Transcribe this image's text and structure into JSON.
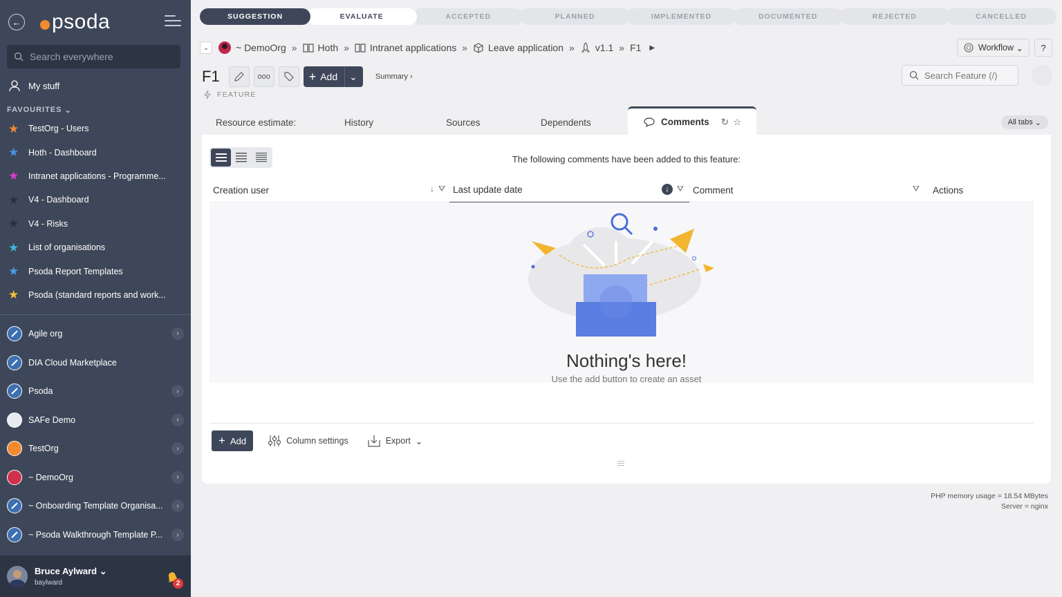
{
  "sidebar": {
    "logo_text": "psoda",
    "search_placeholder": "Search everywhere",
    "my_stuff": "My stuff",
    "favourites_heading": "FAVOURITES",
    "favourites": [
      {
        "label": "TestOrg - Users",
        "color": "#f28a30"
      },
      {
        "label": "Hoth - Dashboard",
        "color": "#4a90e2"
      },
      {
        "label": "Intranet applications - Programme...",
        "color": "#d63fcf"
      },
      {
        "label": "V4 - Dashboard",
        "color": "#2a2f38"
      },
      {
        "label": "V4 - Risks",
        "color": "#2a2f38"
      },
      {
        "label": "List of organisations",
        "color": "#3fb8d6"
      },
      {
        "label": "Psoda Report Templates",
        "color": "#4aa0e2"
      },
      {
        "label": "Psoda (standard reports and work...",
        "color": "#f2c230"
      }
    ],
    "organisations": [
      {
        "label": "Agile org",
        "avatar": "#3e6fb0",
        "arrow": true
      },
      {
        "label": "DIA Cloud Marketplace",
        "avatar": "#3e6fb0",
        "arrow": false
      },
      {
        "label": "Psoda",
        "avatar": "#3e6fb0",
        "arrow": true
      },
      {
        "label": "SAFe Demo",
        "avatar": "#e8ecf2",
        "arrow": true
      },
      {
        "label": "TestOrg",
        "avatar": "#f28a30",
        "arrow": true
      },
      {
        "label": "~ DemoOrg",
        "avatar": "#d0304a",
        "arrow": true
      },
      {
        "label": "~ Onboarding Template Organisa...",
        "avatar": "#3e6fb0",
        "arrow": true
      },
      {
        "label": "~ Psoda Walkthrough Template P...",
        "avatar": "#3e6fb0",
        "arrow": true
      }
    ],
    "user": {
      "name": "Bruce Aylward",
      "login": "baylward",
      "notifications": "2"
    }
  },
  "stages": [
    {
      "label": "SUGGESTION",
      "state": "current"
    },
    {
      "label": "EVALUATE",
      "state": "next"
    },
    {
      "label": "ACCEPTED",
      "state": ""
    },
    {
      "label": "PLANNED",
      "state": ""
    },
    {
      "label": "IMPLEMENTED",
      "state": ""
    },
    {
      "label": "DOCUMENTED",
      "state": ""
    },
    {
      "label": "REJECTED",
      "state": ""
    },
    {
      "label": "CANCELLED",
      "state": ""
    }
  ],
  "breadcrumb": [
    "~ DemoOrg",
    "Hoth",
    "Intranet applications",
    "Leave application",
    "v1.1",
    "F1"
  ],
  "workflow_label": "Workflow",
  "help_label": "?",
  "title": "F1",
  "type_label": "FEATURE",
  "add_label": "Add",
  "summary_label": "Summary ›",
  "search_feature_placeholder": "Search Feature (/)",
  "tabs": [
    "Resource estimate:",
    "History",
    "Sources",
    "Dependents",
    "Comments"
  ],
  "all_tabs_label": "All tabs",
  "panel": {
    "intro": "The following comments have been added to this feature:",
    "columns": [
      "Creation user",
      "Last update date",
      "Comment",
      "Actions"
    ],
    "empty_title": "Nothing's here!",
    "empty_sub": "Use the add button to create an asset",
    "add_button": "Add",
    "column_settings": "Column settings",
    "export": "Export"
  },
  "footer": {
    "memory": "PHP memory usage = 18.54 MBytes",
    "server": "Server = nginx"
  }
}
